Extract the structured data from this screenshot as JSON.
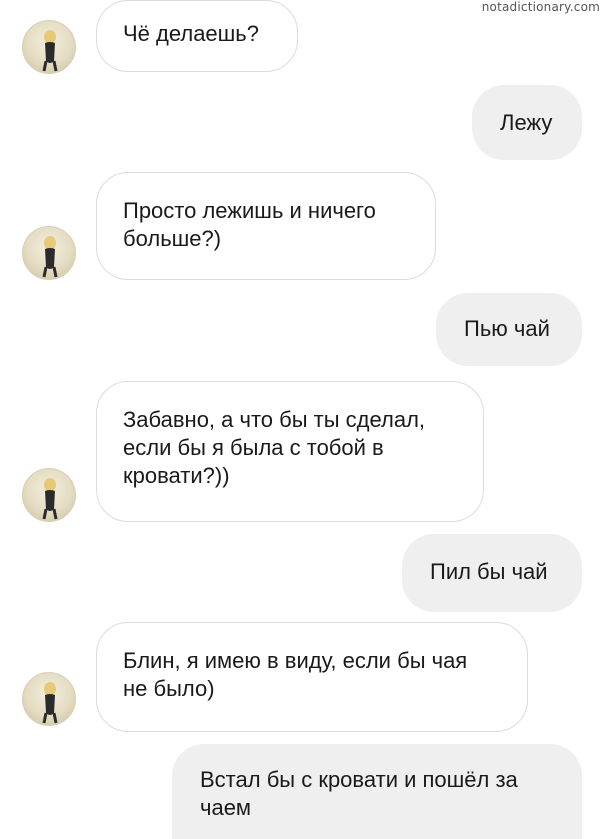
{
  "watermark": "notadictionary.com",
  "messages": [
    {
      "side": "in",
      "text": "Чё делаешь?"
    },
    {
      "side": "out",
      "text": "Лежу"
    },
    {
      "side": "in",
      "text": "Просто лежишь и ничего\nбольше?)"
    },
    {
      "side": "out",
      "text": "Пью чай"
    },
    {
      "side": "in",
      "text": "Забавно, а что бы ты сделал,\nесли бы я была с тобой в\nкровати?))"
    },
    {
      "side": "out",
      "text": "Пил бы чай"
    },
    {
      "side": "in",
      "text": "Блин, я имею в виду, если бы чая\nне было)"
    },
    {
      "side": "out",
      "text": "Встал бы с кровати и пошёл за\nчаем"
    }
  ],
  "avatar": {
    "icon": "contact-avatar-icon"
  },
  "colors": {
    "incoming_bg": "#ffffff",
    "incoming_border": "#dcdcdc",
    "outgoing_bg": "#efefef",
    "text": "#1a1a1a"
  }
}
